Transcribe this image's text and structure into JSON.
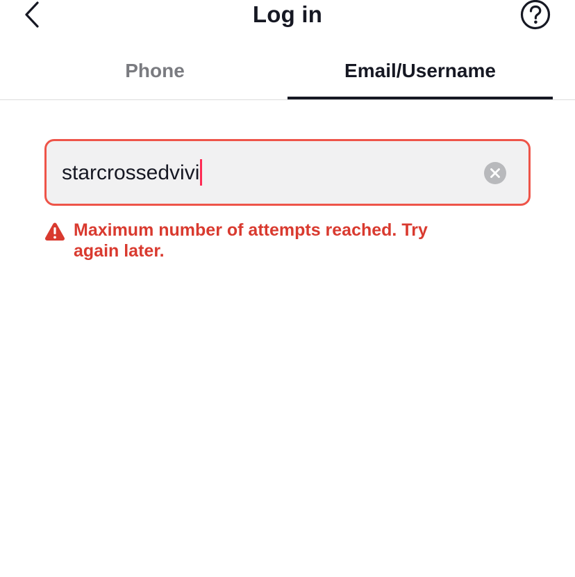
{
  "header": {
    "title": "Log in",
    "back_icon": "chevron-left-icon",
    "help_icon": "question-circle-icon"
  },
  "tabs": [
    {
      "label": "Phone",
      "active": false
    },
    {
      "label": "Email/Username",
      "active": true
    }
  ],
  "form": {
    "username_value": "starcrossedvivi",
    "clear_icon": "clear-circle-icon"
  },
  "error": {
    "icon": "warning-triangle-icon",
    "message": "Maximum number of attempts reached. Try again later."
  },
  "colors": {
    "text_primary": "#161823",
    "text_secondary": "#7a7b80",
    "error": "#d93a2f",
    "input_border_error": "#ee5449",
    "input_background": "#f1f1f2",
    "caret": "#fe2c55"
  }
}
